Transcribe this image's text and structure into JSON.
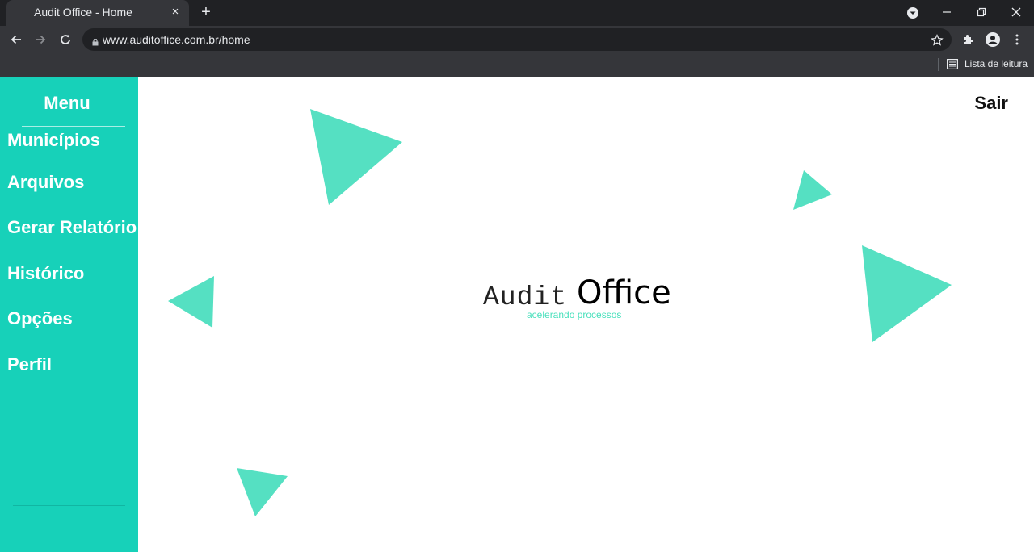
{
  "browser": {
    "tab_title": "Audit Office - Home",
    "tab_close_glyph": "×",
    "new_tab_glyph": "+",
    "url": "www.auditoffice.com.br/home",
    "reading_list_label": "Lista de leitura",
    "icons": [
      "back-icon",
      "forward-icon",
      "reload-icon",
      "lock-icon",
      "star-icon",
      "extensions-icon",
      "profile-icon",
      "more-icon",
      "reading-list-icon",
      "tab-search-icon",
      "minimize-icon",
      "restore-icon",
      "close-window-icon"
    ]
  },
  "sidebar": {
    "title": "Menu",
    "items": [
      {
        "label": "Municípios"
      },
      {
        "label": "Arquivos"
      },
      {
        "label": "Gerar Relatório"
      },
      {
        "label": "Histórico"
      },
      {
        "label": "Opções"
      },
      {
        "label": "Perfil"
      }
    ]
  },
  "header": {
    "logout_label": "Sair"
  },
  "logo": {
    "audit": "Audit",
    "office": "Office",
    "tagline": "acelerando processos"
  },
  "colors": {
    "sidebar_bg": "#17d1b9",
    "decor_triangle": "#55e0c2",
    "tagline": "#49e0bc",
    "chrome_dark": "#202124",
    "chrome_toolbar": "#35363a"
  }
}
